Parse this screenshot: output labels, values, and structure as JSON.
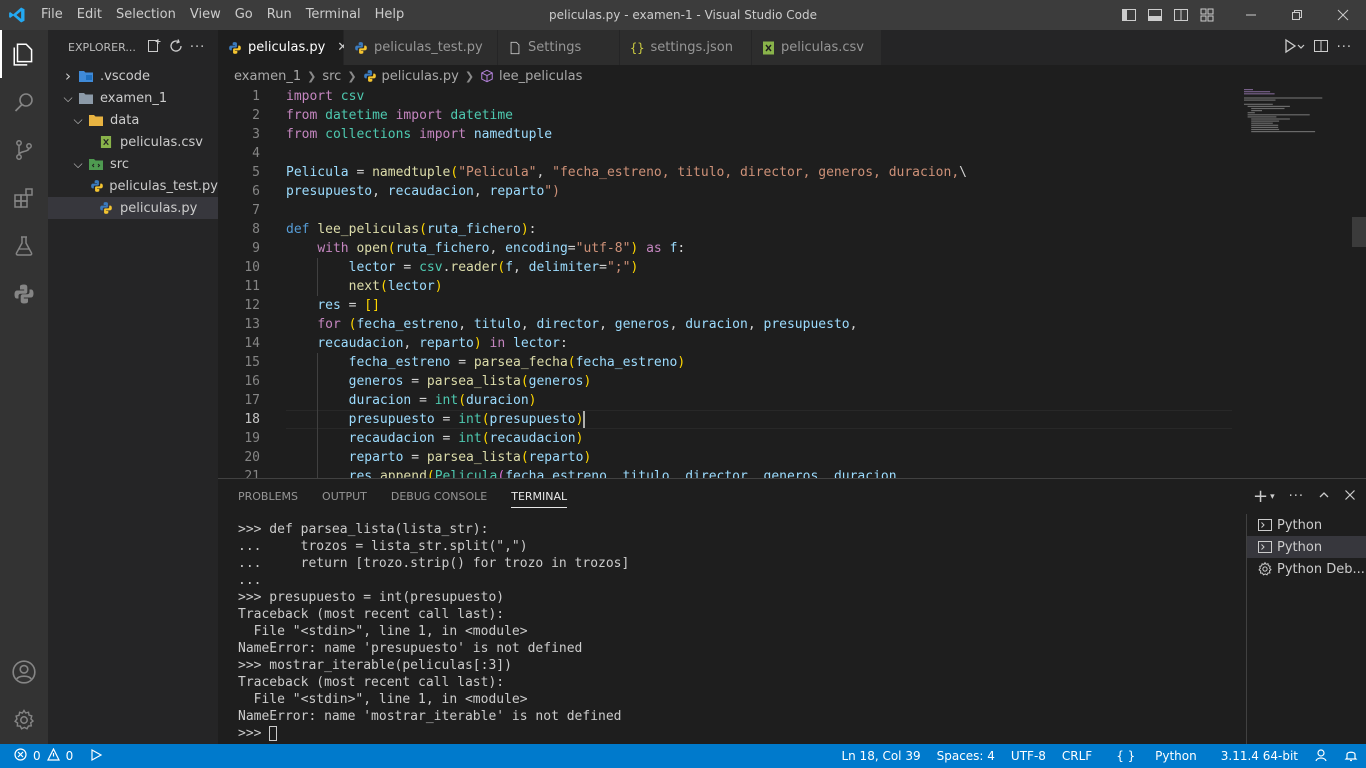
{
  "window": {
    "title": "peliculas.py - examen-1 - Visual Studio Code",
    "menu": [
      "File",
      "Edit",
      "Selection",
      "View",
      "Go",
      "Run",
      "Terminal",
      "Help"
    ]
  },
  "sidebar": {
    "header": "EXPLORER...",
    "tree": [
      {
        "label": ".vscode",
        "type": "folder",
        "expanded": false,
        "depth": 0,
        "icon": "vscode-folder-icon"
      },
      {
        "label": "examen_1",
        "type": "folder",
        "expanded": true,
        "depth": 0,
        "icon": "folder-icon"
      },
      {
        "label": "data",
        "type": "folder",
        "expanded": true,
        "depth": 1,
        "icon": "data-folder-icon"
      },
      {
        "label": "peliculas.csv",
        "type": "file",
        "depth": 2,
        "icon": "csv-file-icon"
      },
      {
        "label": "src",
        "type": "folder",
        "expanded": true,
        "depth": 1,
        "icon": "src-folder-icon"
      },
      {
        "label": "peliculas_test.py",
        "type": "file",
        "depth": 2,
        "icon": "python-file-icon"
      },
      {
        "label": "peliculas.py",
        "type": "file",
        "depth": 2,
        "icon": "python-file-icon",
        "selected": true
      }
    ]
  },
  "tabs": [
    {
      "label": "peliculas.py",
      "icon": "python-file-icon",
      "active": true
    },
    {
      "label": "peliculas_test.py",
      "icon": "python-file-icon",
      "active": false
    },
    {
      "label": "Settings",
      "icon": "settings-file-icon",
      "active": false
    },
    {
      "label": "settings.json",
      "icon": "json-file-icon",
      "active": false
    },
    {
      "label": "peliculas.csv",
      "icon": "csv-file-icon",
      "active": false
    }
  ],
  "breadcrumb": {
    "items": [
      "examen_1",
      "src",
      "peliculas.py",
      "lee_peliculas"
    ]
  },
  "editor": {
    "current_line": 18,
    "lines": [
      {
        "n": "1",
        "text": "import csv"
      },
      {
        "n": "2",
        "text": "from datetime import datetime"
      },
      {
        "n": "3",
        "text": "from collections import namedtuple"
      },
      {
        "n": "4",
        "text": ""
      },
      {
        "n": "5",
        "text": "Pelicula = namedtuple(\"Pelicula\", \"fecha_estreno, titulo, director, generos, duracion,\\"
      },
      {
        "n": "6",
        "text": "presupuesto, recaudacion, reparto\")"
      },
      {
        "n": "7",
        "text": ""
      },
      {
        "n": "8",
        "text": "def lee_peliculas(ruta_fichero):"
      },
      {
        "n": "9",
        "text": "    with open(ruta_fichero, encoding=\"utf-8\") as f:"
      },
      {
        "n": "10",
        "text": "        lector = csv.reader(f, delimiter=\";\")"
      },
      {
        "n": "11",
        "text": "        next(lector)"
      },
      {
        "n": "12",
        "text": "    res = []"
      },
      {
        "n": "13",
        "text": "    for (fecha_estreno, titulo, director, generos, duracion, presupuesto,"
      },
      {
        "n": "14",
        "text": "    recaudacion, reparto) in lector:"
      },
      {
        "n": "15",
        "text": "        fecha_estreno = parsea_fecha(fecha_estreno)"
      },
      {
        "n": "16",
        "text": "        generos = parsea_lista(generos)"
      },
      {
        "n": "17",
        "text": "        duracion = int(duracion)"
      },
      {
        "n": "18",
        "text": "        presupuesto = int(presupuesto)"
      },
      {
        "n": "19",
        "text": "        recaudacion = int(recaudacion)"
      },
      {
        "n": "20",
        "text": "        reparto = parsea_lista(reparto)"
      },
      {
        "n": "21",
        "text": "        res.append(Pelicula(fecha_estreno, titulo, director, generos, duracion,"
      }
    ]
  },
  "panel": {
    "tabs": [
      "PROBLEMS",
      "OUTPUT",
      "DEBUG CONSOLE",
      "TERMINAL"
    ],
    "active_tab": "TERMINAL",
    "terminal_lines": [
      ">>> def parsea_lista(lista_str):",
      "...     trozos = lista_str.split(\",\")",
      "...     return [trozo.strip() for trozo in trozos]",
      "...",
      ">>> presupuesto = int(presupuesto)",
      "Traceback (most recent call last):",
      "  File \"<stdin>\", line 1, in <module>",
      "NameError: name 'presupuesto' is not defined",
      ">>> mostrar_iterable(peliculas[:3])",
      "Traceback (most recent call last):",
      "  File \"<stdin>\", line 1, in <module>",
      "NameError: name 'mostrar_iterable' is not defined"
    ],
    "prompt": ">>> ",
    "terminal_list": [
      {
        "label": "Python",
        "selected": false,
        "icon": "terminal-icon"
      },
      {
        "label": "Python",
        "selected": true,
        "icon": "terminal-icon"
      },
      {
        "label": "Python Deb...",
        "selected": false,
        "icon": "debug-gear-icon"
      }
    ]
  },
  "statusbar": {
    "errors": "0",
    "warnings": "0",
    "position": "Ln 18, Col 39",
    "spaces": "Spaces: 4",
    "encoding": "UTF-8",
    "eol": "CRLF",
    "language": "Python",
    "interpreter": "3.11.4 64-bit"
  },
  "colors": {
    "accent": "#007acc",
    "titlebar": "#3c3c3c",
    "activitybar": "#333333",
    "sidebar": "#252526",
    "editor": "#1e1e1e"
  }
}
